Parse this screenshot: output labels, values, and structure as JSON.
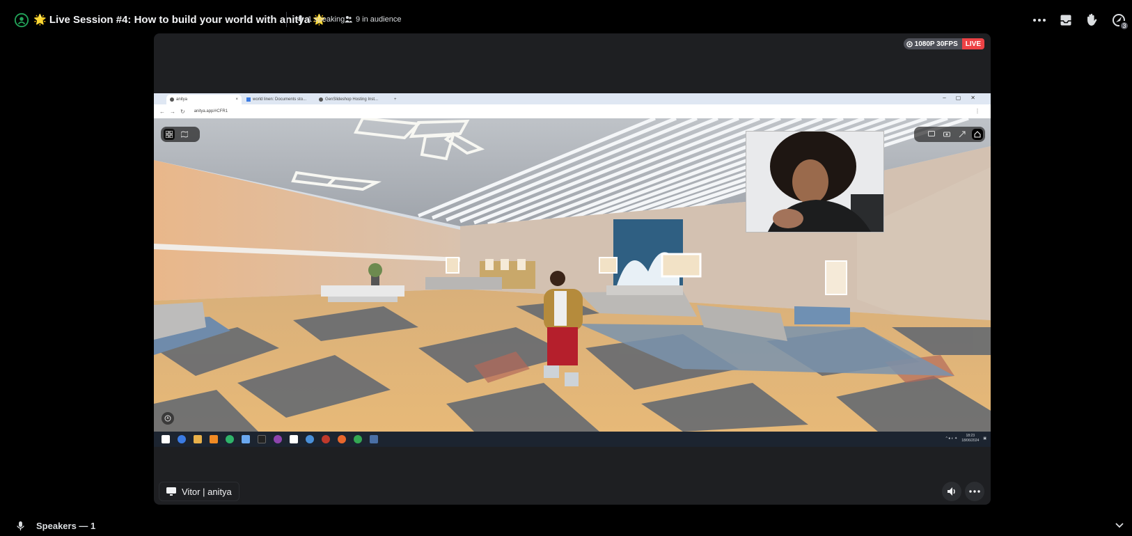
{
  "header": {
    "title_prefix": "🌟",
    "title": "Live Session #4: How to build your world with anitya",
    "title_suffix": "🌟",
    "speaking": "1 speaking",
    "audience": "9 in audience",
    "notification_count": "3"
  },
  "stream": {
    "quality": "1080P 30FPS",
    "live": "LIVE",
    "streamer": "Vitor | anitya"
  },
  "browser": {
    "tabs": [
      "anitya",
      "world linen: Documents sto...",
      "GenSlideshop Hosting Inst..."
    ],
    "new_tab": "+",
    "url": "anitya.app/#CFR1"
  },
  "taskbar": {
    "time": "18:23",
    "date": "18/06/2024",
    "icon_colors": [
      "#ffffff",
      "#3b7be3",
      "#e8b04a",
      "#f08a24",
      "#2fb46a",
      "#6aa8f0",
      "#222222",
      "#8e44ad",
      "#ffffff",
      "#4a90d9",
      "#c0392b",
      "#e8672c",
      "#34a853",
      "#4a6fa5"
    ]
  },
  "footer": {
    "speakers_label": "Speakers — 1"
  },
  "colors": {
    "live": "#ed4245",
    "stage_green": "#23a55a",
    "panel": "#1e1f22"
  }
}
